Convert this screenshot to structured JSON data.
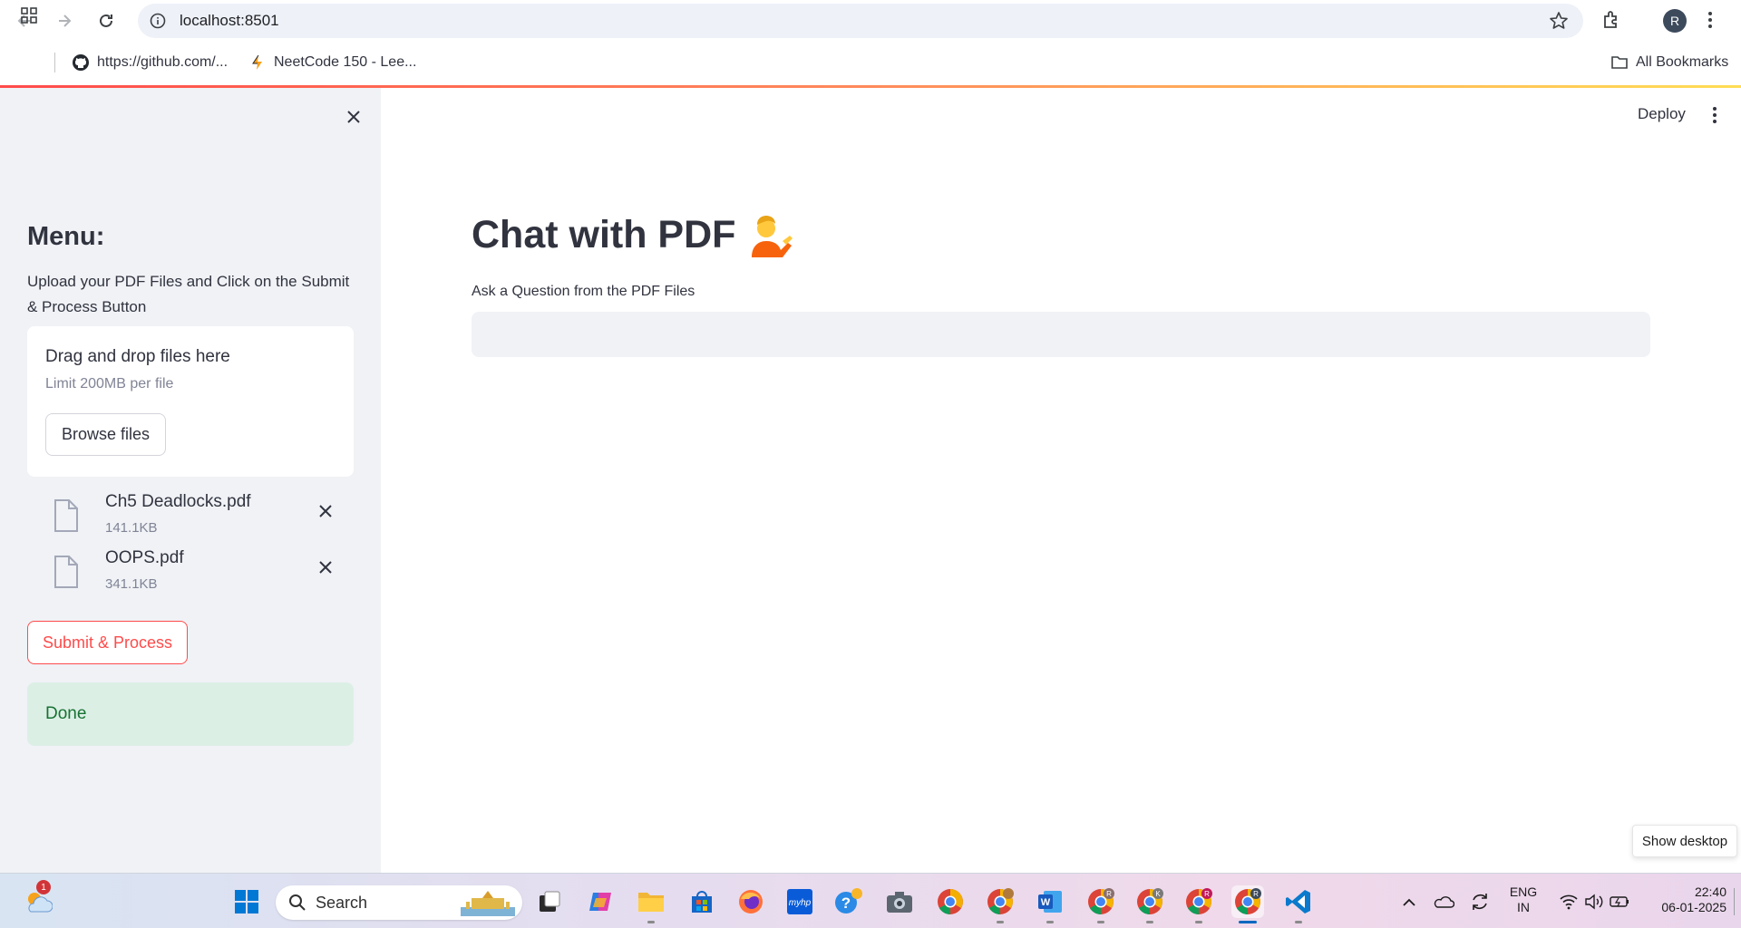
{
  "browser": {
    "url": "localhost:8501",
    "profile_initial": "R",
    "bookmarks": [
      {
        "label": "https://github.com/...",
        "icon": "github-icon"
      },
      {
        "label": "NeetCode 150 - Lee...",
        "icon": "neetcode-icon"
      }
    ],
    "all_bookmarks": "All Bookmarks"
  },
  "sidebar": {
    "title": "Menu:",
    "description": "Upload your PDF Files and Click on the Submit & Process Button",
    "dropzone": {
      "title": "Drag and drop files here",
      "limit": "Limit 200MB per file",
      "browse_label": "Browse files"
    },
    "files": [
      {
        "name": "Ch5 Deadlocks.pdf",
        "size": "141.1KB"
      },
      {
        "name": "OOPS.pdf",
        "size": "341.1KB"
      }
    ],
    "submit_label": "Submit & Process",
    "status": "Done"
  },
  "main": {
    "deploy_label": "Deploy",
    "title": "Chat with PDF",
    "question_label": "Ask a Question from the PDF Files",
    "question_value": ""
  },
  "taskbar": {
    "weather_badge": "1",
    "search_label": "Search",
    "language": "ENG",
    "region": "IN",
    "time": "22:40",
    "date": "06-01-2025",
    "show_desktop": "Show desktop"
  },
  "colors": {
    "accent": "#ff4b4b",
    "sidebar_bg": "#f0f2f6",
    "success_bg": "#dcefe5",
    "success_text": "#177233"
  }
}
